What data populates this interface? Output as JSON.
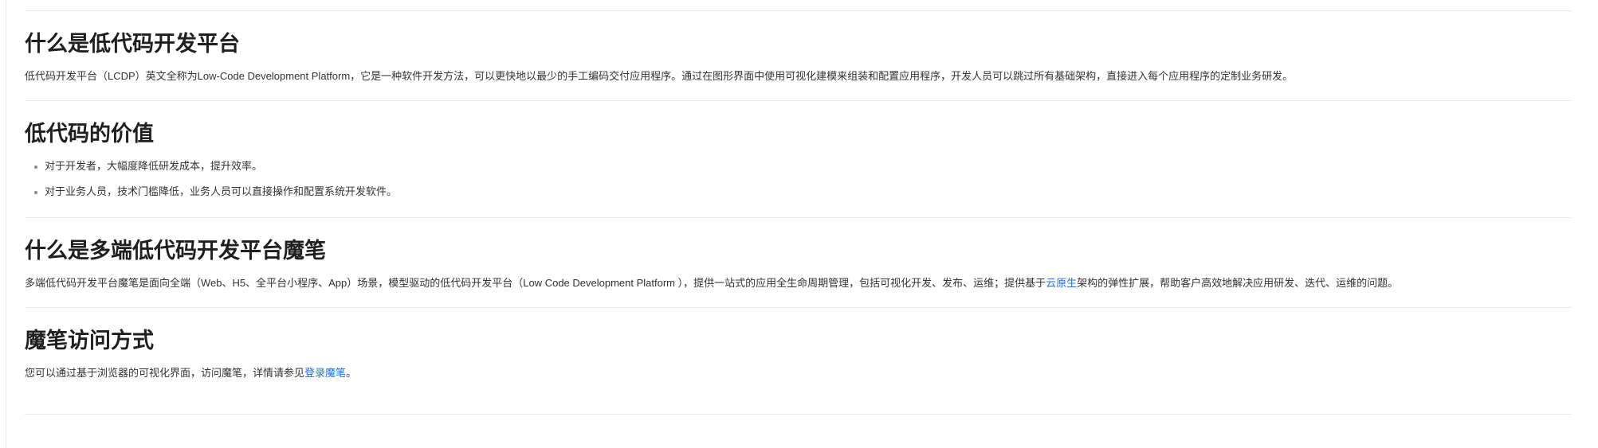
{
  "sections": [
    {
      "heading": "什么是低代码开发平台",
      "paragraph": "低代码开发平台（LCDP）英文全称为Low-Code Development Platform，它是一种软件开发方法，可以更快地以最少的手工编码交付应用程序。通过在图形界面中使用可视化建模来组装和配置应用程序，开发人员可以跳过所有基础架构，直接进入每个应用程序的定制业务研发。"
    },
    {
      "heading": "低代码的价值",
      "items": [
        "对于开发者，大幅度降低研发成本，提升效率。",
        "对于业务人员，技术门槛降低，业务人员可以直接操作和配置系统开发软件。"
      ]
    },
    {
      "heading": "什么是多端低代码开发平台魔笔",
      "paragraph_before": "多端低代码开发平台魔笔是面向全端（Web、H5、全平台小程序、App）场景，模型驱动的低代码开发平台（Low Code Development Platform ），提供一站式的应用全生命周期管理，包括可视化开发、发布、运维；提供基于",
      "link": "云原生",
      "paragraph_after": "架构的弹性扩展，帮助客户高效地解决应用研发、迭代、运维的问题。"
    },
    {
      "heading": "魔笔访问方式",
      "paragraph_before": "您可以通过基于浏览器的可视化界面，访问魔笔，详情请参见",
      "link": "登录魔笔",
      "paragraph_after": "。"
    }
  ],
  "colors": {
    "link": "#1a73e8",
    "divider": "#e8e8e8",
    "heading": "#1f1f1f",
    "text": "#333333"
  }
}
